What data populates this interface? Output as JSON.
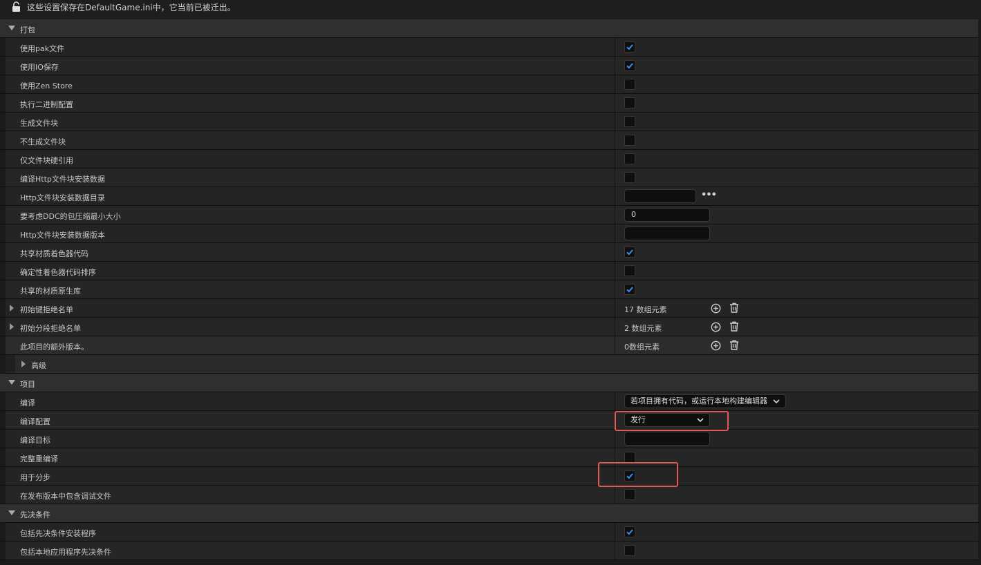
{
  "banner": {
    "message": "这些设置保存在DefaultGame.ini中，它当前已被迁出。"
  },
  "sections": {
    "packaging": "打包",
    "project": "项目",
    "prerequisites": "先决条件"
  },
  "packaging": {
    "use_pak": {
      "label": "使用pak文件",
      "checked": true
    },
    "use_io_store": {
      "label": "使用IO保存",
      "checked": true
    },
    "use_zen_store": {
      "label": "使用Zen Store",
      "checked": false
    },
    "binary_config": {
      "label": "执行二进制配置",
      "checked": false
    },
    "generate_chunks": {
      "label": "生成文件块",
      "checked": false
    },
    "no_chunks": {
      "label": "不生成文件块",
      "checked": false
    },
    "chunk_hard_refs": {
      "label": "仅文件块硬引用",
      "checked": false
    },
    "http_chunk_install": {
      "label": "编译Http文件块安装数据",
      "checked": false
    },
    "http_chunk_dir": {
      "label": "Http文件块安装数据目录",
      "value": "",
      "browse": "•••"
    },
    "ddc_min_size": {
      "label": "要考虑DDC的包压缩最小大小",
      "value": "0"
    },
    "http_chunk_version": {
      "label": "Http文件块安装数据版本",
      "value": ""
    },
    "share_shader_code": {
      "label": "共享材质着色器代码",
      "checked": true
    },
    "deterministic_shader": {
      "label": "确定性着色器代码排序",
      "checked": false
    },
    "shared_material_lib": {
      "label": "共享的材质原生库",
      "checked": true
    },
    "initial_key_denylist": {
      "label": "初始键拒绝名单",
      "count": "17 数组元素"
    },
    "initial_chunk_denylist": {
      "label": "初始分段拒绝名单",
      "count": "2 数组元素"
    },
    "extra_versions": {
      "label": "此项目的额外版本。",
      "count": "0数组元素"
    },
    "advanced": "高级"
  },
  "project": {
    "build": {
      "label": "编译",
      "value": "若项目拥有代码，或运行本地构建编辑器"
    },
    "build_config": {
      "label": "编译配置",
      "value": "发行"
    },
    "build_target": {
      "label": "编译目标",
      "value": ""
    },
    "full_rebuild": {
      "label": "完整重编译",
      "checked": false
    },
    "for_distribution": {
      "label": "用于分步",
      "checked": true
    },
    "include_debug": {
      "label": "在发布版本中包含调试文件",
      "checked": false
    }
  },
  "prerequisites": {
    "include_installer": {
      "label": "包括先决条件安装程序",
      "checked": true
    },
    "include_app_local": {
      "label": "包括本地应用程序先决条件",
      "checked": false
    }
  },
  "colors": {
    "check": "#3d8ff0",
    "highlight": "#e05a5a"
  }
}
